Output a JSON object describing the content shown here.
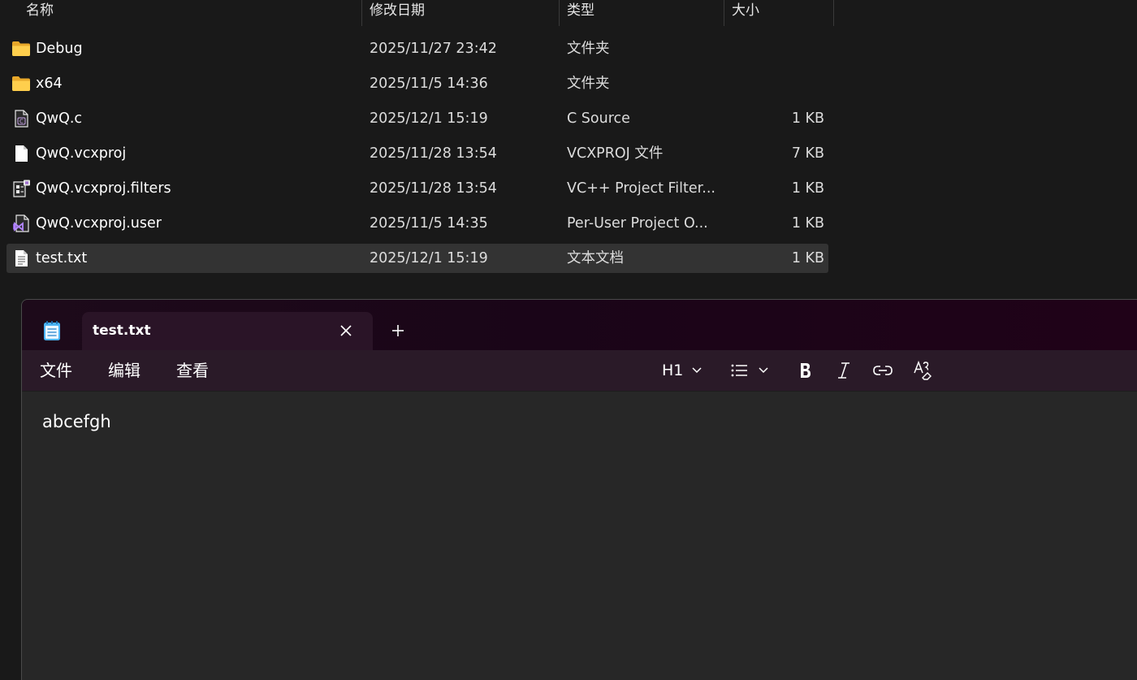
{
  "explorer": {
    "columns": {
      "name": "名称",
      "date": "修改日期",
      "type": "类型",
      "size": "大小"
    },
    "files": [
      {
        "name": "Debug",
        "date": "2025/11/27 23:42",
        "type": "文件夹",
        "size": "",
        "icon": "folder-icon",
        "selected": false
      },
      {
        "name": "x64",
        "date": "2025/11/5 14:36",
        "type": "文件夹",
        "size": "",
        "icon": "folder-icon",
        "selected": false
      },
      {
        "name": "QwQ.c",
        "date": "2025/12/1 15:19",
        "type": "C Source",
        "size": "1 KB",
        "icon": "c-source-file-icon",
        "selected": false
      },
      {
        "name": "QwQ.vcxproj",
        "date": "2025/11/28 13:54",
        "type": "VCXPROJ 文件",
        "size": "7 KB",
        "icon": "blank-file-icon",
        "selected": false
      },
      {
        "name": "QwQ.vcxproj.filters",
        "date": "2025/11/28 13:54",
        "type": "VC++ Project Filter...",
        "size": "1 KB",
        "icon": "filters-file-icon",
        "selected": false
      },
      {
        "name": "QwQ.vcxproj.user",
        "date": "2025/11/5 14:35",
        "type": "Per-User Project O...",
        "size": "1 KB",
        "icon": "visual-studio-file-icon",
        "selected": false
      },
      {
        "name": "test.txt",
        "date": "2025/12/1 15:19",
        "type": "文本文档",
        "size": "1 KB",
        "icon": "text-file-icon",
        "selected": true
      }
    ]
  },
  "notepad": {
    "tab_title": "test.txt",
    "menu": {
      "file": "文件",
      "edit": "编辑",
      "view": "查看"
    },
    "toolbar": {
      "heading": "H1"
    },
    "content": "abcefgh",
    "colors": {
      "titlebar": "#1a0518",
      "menubar": "#2a1a28",
      "editor": "#272727",
      "tab": "#2a1427"
    }
  }
}
